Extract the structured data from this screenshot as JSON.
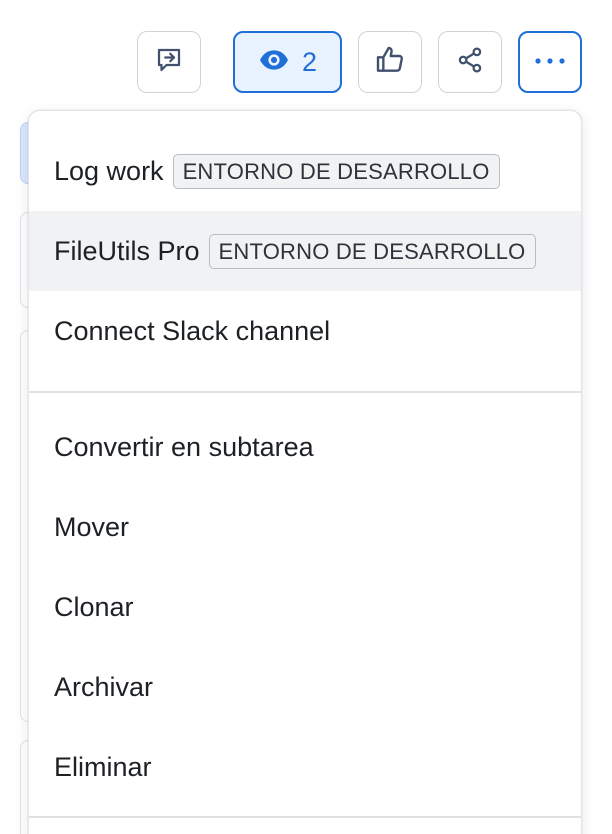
{
  "toolbar": {
    "watch_count": "2",
    "buttons": [
      {
        "name": "feedback-button",
        "icon": "feedback-icon"
      },
      {
        "name": "watch-button",
        "icon": "eye-icon"
      },
      {
        "name": "like-button",
        "icon": "thumbs-up-icon"
      },
      {
        "name": "share-button",
        "icon": "share-icon"
      },
      {
        "name": "more-actions-button",
        "icon": "more-horizontal-icon"
      }
    ],
    "accent_color": "#1f6fd6"
  },
  "menu": {
    "group1": [
      {
        "label": "Log work",
        "badge": "ENTORNO DE DESARROLLO"
      },
      {
        "label": "FileUtils Pro",
        "badge": "ENTORNO DE DESARROLLO"
      },
      {
        "label": "Connect Slack channel"
      }
    ],
    "group2": [
      {
        "label": "Convertir en subtarea"
      },
      {
        "label": "Mover"
      },
      {
        "label": "Clonar"
      },
      {
        "label": "Archivar"
      },
      {
        "label": "Eliminar"
      }
    ]
  }
}
